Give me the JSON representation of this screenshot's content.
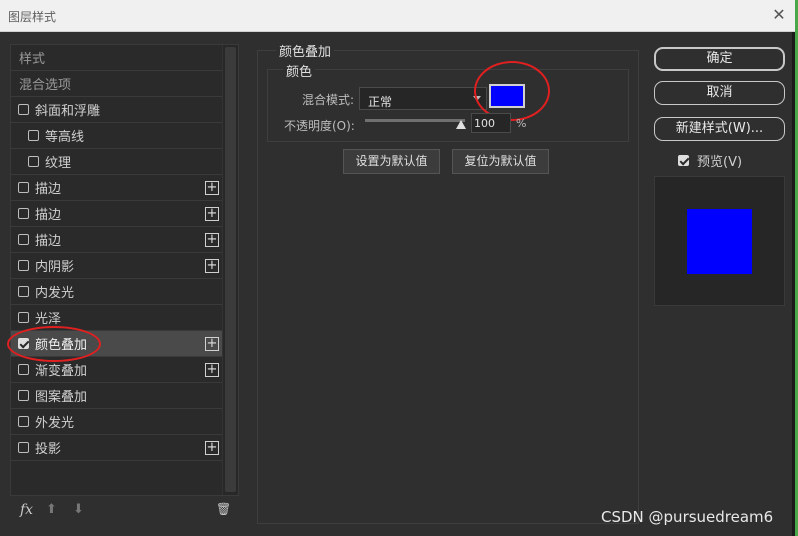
{
  "window": {
    "title": "图层样式",
    "close_glyph": "✕"
  },
  "styles_list": {
    "header_label": "样式",
    "blend_options_label": "混合选项",
    "items": [
      {
        "label": "斜面和浮雕",
        "checked": false,
        "indent": false,
        "has_add": false
      },
      {
        "label": "等高线",
        "checked": false,
        "indent": true,
        "has_add": false
      },
      {
        "label": "纹理",
        "checked": false,
        "indent": true,
        "has_add": false
      },
      {
        "label": "描边",
        "checked": false,
        "indent": false,
        "has_add": true
      },
      {
        "label": "描边",
        "checked": false,
        "indent": false,
        "has_add": true
      },
      {
        "label": "描边",
        "checked": false,
        "indent": false,
        "has_add": true
      },
      {
        "label": "内阴影",
        "checked": false,
        "indent": false,
        "has_add": true
      },
      {
        "label": "内发光",
        "checked": false,
        "indent": false,
        "has_add": false
      },
      {
        "label": "光泽",
        "checked": false,
        "indent": false,
        "has_add": false
      },
      {
        "label": "颜色叠加",
        "checked": true,
        "indent": false,
        "has_add": true,
        "selected": true
      },
      {
        "label": "渐变叠加",
        "checked": false,
        "indent": false,
        "has_add": true
      },
      {
        "label": "图案叠加",
        "checked": false,
        "indent": false,
        "has_add": false
      },
      {
        "label": "外发光",
        "checked": false,
        "indent": false,
        "has_add": false
      },
      {
        "label": "投影",
        "checked": false,
        "indent": false,
        "has_add": true
      }
    ],
    "add_glyph": "+",
    "tools": {
      "fx": "fx",
      "up": "⬆",
      "down": "⬇",
      "trash": "🗑"
    }
  },
  "color_overlay": {
    "group_title": "颜色叠加",
    "sub_title": "颜色",
    "blend_mode_label": "混合模式:",
    "blend_mode_value": "正常",
    "overlay_color": "#0000ff",
    "opacity_label": "不透明度(O):",
    "opacity_value": "100",
    "opacity_unit": "%",
    "opacity_fraction": 1.0,
    "set_default_label": "设置为默认值",
    "reset_default_label": "复位为默认值"
  },
  "actions": {
    "ok_label": "确定",
    "cancel_label": "取消",
    "new_style_label": "新建样式(W)...",
    "preview_label": "预览(V)",
    "preview_checked": true
  },
  "preview": {
    "fill_color": "#0000ff"
  },
  "annotation_color": "#e02020",
  "watermark": "CSDN @pursuedream6"
}
